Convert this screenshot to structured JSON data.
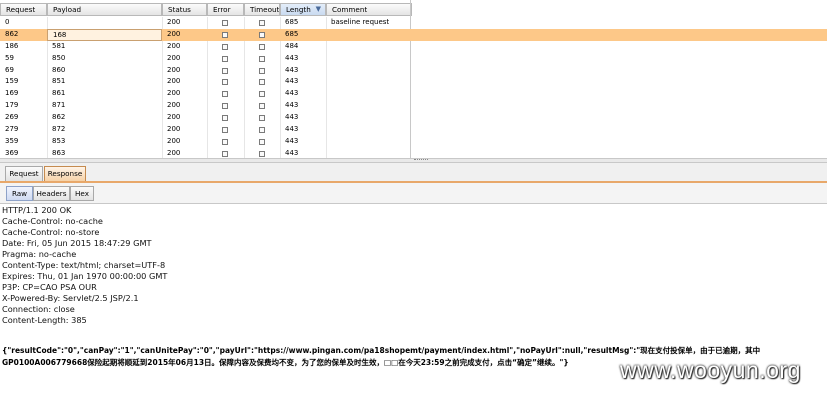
{
  "table": {
    "columns": [
      "Request",
      "Payload",
      "Status",
      "Error",
      "Timeout",
      "Length",
      "Comment"
    ],
    "sorted_column": "Length",
    "rows": [
      {
        "request": "0",
        "payload": "",
        "status": "200",
        "length": "685",
        "comment": "baseline request",
        "selected": false
      },
      {
        "request": "862",
        "payload": "168",
        "status": "200",
        "length": "685",
        "comment": "",
        "selected": true
      },
      {
        "request": "186",
        "payload": "581",
        "status": "200",
        "length": "484",
        "comment": "",
        "selected": false
      },
      {
        "request": "59",
        "payload": "850",
        "status": "200",
        "length": "443",
        "comment": "",
        "selected": false
      },
      {
        "request": "69",
        "payload": "860",
        "status": "200",
        "length": "443",
        "comment": "",
        "selected": false
      },
      {
        "request": "159",
        "payload": "851",
        "status": "200",
        "length": "443",
        "comment": "",
        "selected": false
      },
      {
        "request": "169",
        "payload": "861",
        "status": "200",
        "length": "443",
        "comment": "",
        "selected": false
      },
      {
        "request": "179",
        "payload": "871",
        "status": "200",
        "length": "443",
        "comment": "",
        "selected": false
      },
      {
        "request": "269",
        "payload": "862",
        "status": "200",
        "length": "443",
        "comment": "",
        "selected": false
      },
      {
        "request": "279",
        "payload": "872",
        "status": "200",
        "length": "443",
        "comment": "",
        "selected": false
      },
      {
        "request": "359",
        "payload": "853",
        "status": "200",
        "length": "443",
        "comment": "",
        "selected": false
      },
      {
        "request": "369",
        "payload": "863",
        "status": "200",
        "length": "443",
        "comment": "",
        "selected": false
      }
    ]
  },
  "tabs": {
    "main": [
      {
        "label": "Request",
        "active": false
      },
      {
        "label": "Response",
        "active": true
      }
    ],
    "view": [
      {
        "label": "Raw",
        "active": true
      },
      {
        "label": "Headers",
        "active": false
      },
      {
        "label": "Hex",
        "active": false
      }
    ]
  },
  "response": {
    "headers": [
      "HTTP/1.1 200 OK",
      "Cache-Control: no-cache",
      "Cache-Control: no-store",
      "Date: Fri, 05 Jun 2015 18:47:29 GMT",
      "Pragma: no-cache",
      "Content-Type: text/html; charset=UTF-8",
      "Expires: Thu, 01 Jan 1970 00:00:00 GMT",
      "P3P: CP=CAO PSA OUR",
      "X-Powered-By: Servlet/2.5 JSP/2.1",
      "Connection: close",
      "Content-Length: 385"
    ],
    "body_line1": "{\"resultCode\":\"0\",\"canPay\":\"1\",\"canUnitePay\":\"0\",\"payUrl\":\"https://www.pingan.com/pa18shopemt/payment/index.html\",\"noPayUrl\":null,\"resultMsg\":\"现在支付投保单，由于已逾期，其中",
    "body_line2": "GP0100A006779668保险起期将顺延到2015年06月13日。保障内容及保费均不变，为了您的保单及时生效，□□在今天23:59之前完成支付，点击“确定”继续。\"}"
  },
  "watermark": "www.wooyun.org",
  "colors": {
    "selected_row": "#fdc888",
    "active_tab": "#f6d2a8",
    "sorted_header": "#c9daf0"
  }
}
